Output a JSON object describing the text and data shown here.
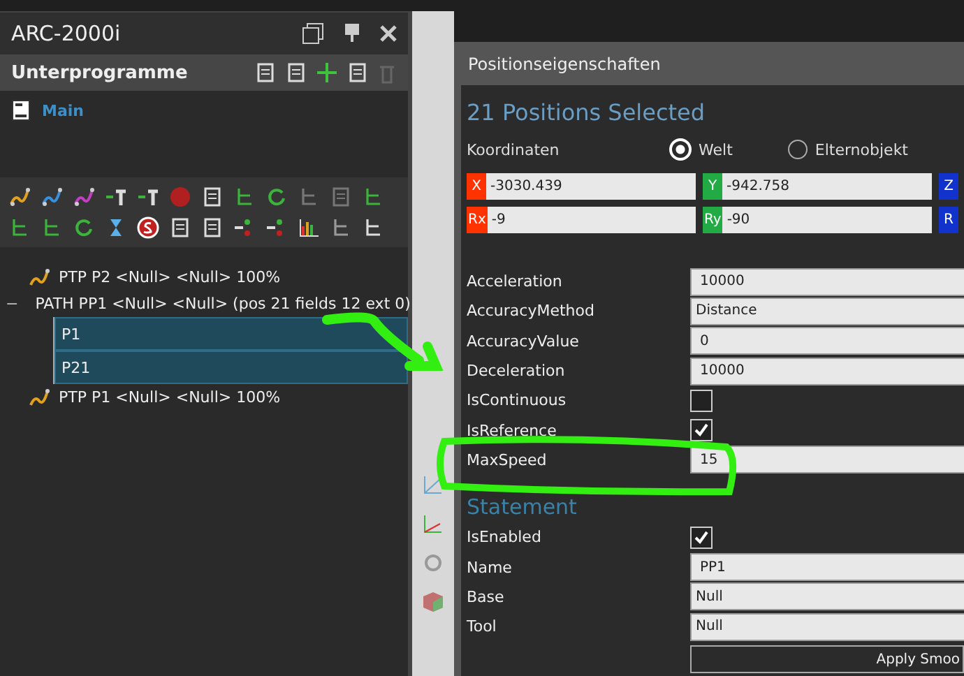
{
  "panel": {
    "title": "ARC-2000i",
    "section": "Unterprogramme",
    "routines": [
      {
        "label": "Main",
        "selected": false
      }
    ],
    "tree": [
      {
        "label": "PTP P2 <Null> <Null> 100%",
        "kind": "ptp",
        "selected": false
      },
      {
        "label": "PATH PP1 <Null> <Null> (pos 21 fields 12 ext 0)",
        "kind": "path",
        "toggle": "−",
        "expanded": true,
        "selected": false,
        "children": [
          {
            "label": "P1",
            "kind": "point",
            "selected": true
          },
          {
            "label": "P21",
            "kind": "point",
            "selected": true
          }
        ]
      },
      {
        "label": "PTP P1 <Null> <Null> 100%",
        "kind": "ptp",
        "selected": false
      }
    ]
  },
  "dialog": {
    "title": "Positionseigenschaften",
    "heading": "21 Positions Selected",
    "coord_label": "Koordinaten",
    "coord_options": [
      {
        "label": "Welt",
        "selected": true
      },
      {
        "label": "Elternobjekt",
        "selected": false
      }
    ],
    "coords": [
      {
        "tag": "X",
        "value": "-3030.439",
        "color": "#ff3300"
      },
      {
        "tag": "Y",
        "value": "-942.758",
        "color": "#22aa44"
      },
      {
        "tag": "Z",
        "color": "#1133cc"
      },
      {
        "tag": "Rx",
        "value": "-9",
        "color": "#ff3300"
      },
      {
        "tag": "Ry",
        "value": "-90",
        "color": "#22aa44"
      },
      {
        "tag": "R",
        "color": "#1133cc"
      }
    ],
    "properties": [
      {
        "name": "Acceleration",
        "kind": "text",
        "value": "10000"
      },
      {
        "name": "AccuracyMethod",
        "kind": "dropdown",
        "value": "Distance"
      },
      {
        "name": "AccuracyValue",
        "kind": "text",
        "value": "0"
      },
      {
        "name": "Deceleration",
        "kind": "text",
        "value": "10000"
      },
      {
        "name": "IsContinuous",
        "kind": "check",
        "checked": false
      },
      {
        "name": "IsReference",
        "kind": "check",
        "checked": true
      },
      {
        "name": "MaxSpeed",
        "kind": "text",
        "value": "15"
      }
    ],
    "statement_heading": "Statement",
    "statement": [
      {
        "name": "IsEnabled",
        "kind": "check",
        "checked": true
      },
      {
        "name": "Name",
        "kind": "text",
        "value": "PP1"
      },
      {
        "name": "Base",
        "kind": "dropdown",
        "value": "Null"
      },
      {
        "name": "Tool",
        "kind": "dropdown",
        "value": "Null"
      }
    ],
    "apply_button": "Apply Smoo"
  }
}
